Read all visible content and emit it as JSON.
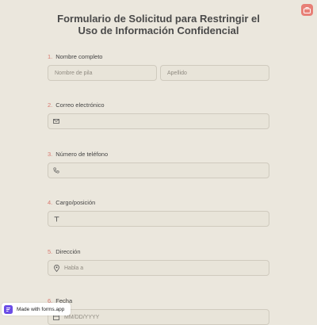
{
  "form": {
    "title": "Formulario de Solicitud para Restringir el Uso de Información Confidencial",
    "fields": [
      {
        "number": "1.",
        "label": "Nombre completo",
        "first_placeholder": "Nombre de pila",
        "last_placeholder": "Apellido"
      },
      {
        "number": "2.",
        "label": "Correo electrónico",
        "icon": "envelope-icon",
        "placeholder": ""
      },
      {
        "number": "3.",
        "label": "Número de teléfono",
        "icon": "phone-icon",
        "placeholder": ""
      },
      {
        "number": "4.",
        "label": "Cargo/posición",
        "icon": "text-icon",
        "placeholder": ""
      },
      {
        "number": "5.",
        "label": "Dirección",
        "icon": "location-pin-icon",
        "placeholder": "Habla a"
      },
      {
        "number": "6.",
        "label": "Fecha",
        "icon": "calendar-icon",
        "placeholder": "MM/DD/YYYY"
      }
    ]
  },
  "header": {
    "corner_icon": "briefcase-icon"
  },
  "badge": {
    "label": "Made with forms.app",
    "icon": "forms-app-logo"
  },
  "colors": {
    "background": "#ebe7dd",
    "accent": "#e77f76",
    "number": "#d9786e",
    "input_border": "#cfcabe"
  }
}
